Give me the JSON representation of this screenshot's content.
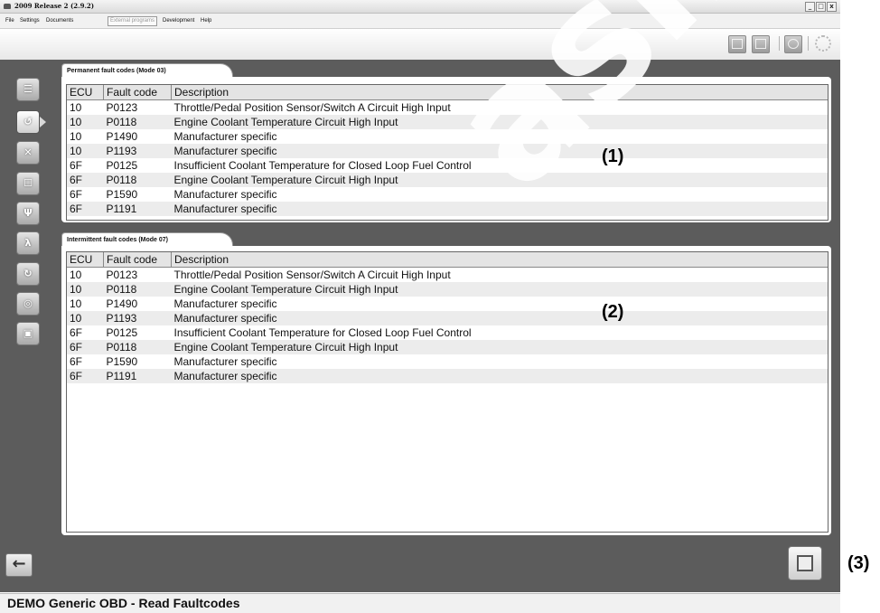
{
  "window": {
    "title": "2009 Release 2 (2.9.2)",
    "buttons": [
      "_",
      "□",
      "x"
    ]
  },
  "menu": {
    "items": [
      "File",
      "Settings",
      "Documents",
      "External programs",
      "Development",
      "Help"
    ],
    "disabled_item": "External programs"
  },
  "toolbar": {
    "icons": [
      "card-icon",
      "device-icon",
      "gauge-icon",
      "spinner-icon"
    ]
  },
  "sidebar": {
    "buttons": [
      {
        "icon": "battery-voltage-icon",
        "glyph": "☰"
      },
      {
        "icon": "fault-codes-icon",
        "glyph": "↺"
      },
      {
        "icon": "mil-off-icon",
        "glyph": "✕"
      },
      {
        "icon": "freeze-frame-icon",
        "glyph": "☐"
      },
      {
        "icon": "sensor-icon",
        "glyph": "Ψ"
      },
      {
        "icon": "lambda-icon",
        "glyph": "λ"
      },
      {
        "icon": "refresh-icon",
        "glyph": "↻"
      },
      {
        "icon": "monitor-icon",
        "glyph": "◎"
      },
      {
        "icon": "vehicle-info-icon",
        "glyph": "▣"
      }
    ],
    "active_index": 1
  },
  "permanent": {
    "tab_label": "Permanent fault codes (Mode 03)",
    "columns": [
      "ECU",
      "Fault code",
      "Description"
    ],
    "rows": [
      [
        "10",
        "P0123",
        "Throttle/Pedal Position Sensor/Switch A Circuit High Input"
      ],
      [
        "10",
        "P0118",
        "Engine Coolant Temperature Circuit High Input"
      ],
      [
        "10",
        "P1490",
        "Manufacturer specific"
      ],
      [
        "10",
        "P1193",
        "Manufacturer specific"
      ],
      [
        "6F",
        "P0125",
        "Insufficient Coolant Temperature for Closed Loop Fuel Control"
      ],
      [
        "6F",
        "P0118",
        "Engine Coolant Temperature Circuit High Input"
      ],
      [
        "6F",
        "P1590",
        "Manufacturer specific"
      ],
      [
        "6F",
        "P1191",
        "Manufacturer specific"
      ]
    ]
  },
  "intermittent": {
    "tab_label": "Intermittent fault codes (Mode 07)",
    "columns": [
      "ECU",
      "Fault code",
      "Description"
    ],
    "rows": [
      [
        "10",
        "P0123",
        "Throttle/Pedal Position Sensor/Switch A Circuit High Input"
      ],
      [
        "10",
        "P0118",
        "Engine Coolant Temperature Circuit High Input"
      ],
      [
        "10",
        "P1490",
        "Manufacturer specific"
      ],
      [
        "10",
        "P1193",
        "Manufacturer specific"
      ],
      [
        "6F",
        "P0125",
        "Insufficient Coolant Temperature for Closed Loop Fuel Control"
      ],
      [
        "6F",
        "P0118",
        "Engine Coolant Temperature Circuit High Input"
      ],
      [
        "6F",
        "P1590",
        "Manufacturer specific"
      ],
      [
        "6F",
        "P1191",
        "Manufacturer specific"
      ]
    ]
  },
  "annotations": {
    "one": "(1)",
    "two": "(2)",
    "three": "(3)"
  },
  "back_button": {
    "glyph": "🡠",
    "icon": "arrow-left-icon"
  },
  "save_button": {
    "icon": "save-report-icon"
  },
  "status": {
    "text": "DEMO Generic OBD - Read Faultcodes"
  },
  "watermark": {
    "text": "asinoy.co"
  }
}
